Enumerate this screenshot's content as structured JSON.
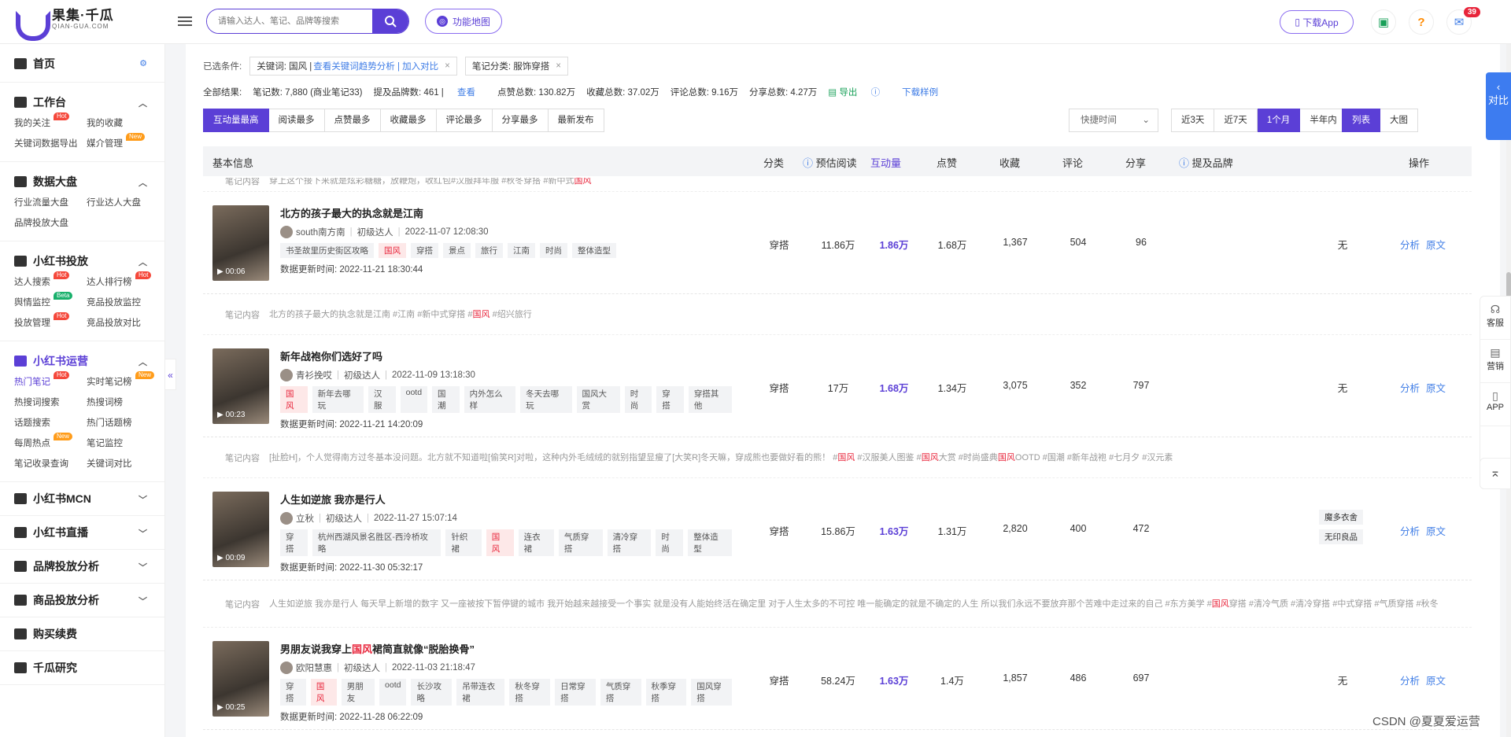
{
  "topbar": {
    "logo_title": "果集·千瓜",
    "logo_sub": "QIAN-GUA.COM",
    "search_placeholder": "请输入达人、笔记、品牌等搜索",
    "func_map": "功能地图",
    "download_app": "下载App",
    "msg_count": "39"
  },
  "sidebar": {
    "home": "首页",
    "sections": [
      {
        "title": "工作台",
        "items": [
          {
            "label": "我的关注",
            "tag": "Hot"
          },
          {
            "label": "我的收藏",
            "tag": ""
          },
          {
            "label": "关键词数据导出",
            "tag": ""
          },
          {
            "label": "媒介管理",
            "tag": "New"
          }
        ]
      },
      {
        "title": "数据大盘",
        "items": [
          {
            "label": "行业流量大盘",
            "tag": ""
          },
          {
            "label": "行业达人大盘",
            "tag": ""
          },
          {
            "label": "品牌投放大盘",
            "tag": ""
          }
        ]
      },
      {
        "title": "小红书投放",
        "items": [
          {
            "label": "达人搜索",
            "tag": "Hot"
          },
          {
            "label": "达人排行榜",
            "tag": "Hot"
          },
          {
            "label": "舆情监控",
            "tag": "Beta"
          },
          {
            "label": "竞品投放监控",
            "tag": ""
          },
          {
            "label": "投放管理",
            "tag": "Hot"
          },
          {
            "label": "竞品投放对比",
            "tag": ""
          }
        ]
      },
      {
        "title": "小红书运营",
        "items": [
          {
            "label": "热门笔记",
            "tag": "Hot"
          },
          {
            "label": "实时笔记榜",
            "tag": "New"
          },
          {
            "label": "热搜词搜索",
            "tag": ""
          },
          {
            "label": "热搜词榜",
            "tag": ""
          },
          {
            "label": "话题搜索",
            "tag": ""
          },
          {
            "label": "热门话题榜",
            "tag": ""
          },
          {
            "label": "每周热点",
            "tag": "New"
          },
          {
            "label": "笔记监控",
            "tag": ""
          },
          {
            "label": "笔记收录查询",
            "tag": ""
          },
          {
            "label": "关键词对比",
            "tag": ""
          }
        ]
      }
    ],
    "collapsed": [
      "小红书MCN",
      "小红书直播",
      "品牌投放分析",
      "商品投放分析",
      "购买续费",
      "千瓜研究"
    ]
  },
  "filters": {
    "label": "已选条件:",
    "chip1_prefix": "关键词: 国风 |",
    "chip1_link": "查看关键词趋势分析 | 加入对比",
    "chip2": "笔记分类: 服饰穿搭"
  },
  "summary": {
    "total": "全部结果:",
    "notes": "笔记数: 7,880 (商业笔记33)",
    "brands": "提及品牌数: 461 |",
    "brands_link": "查看",
    "likes": "点赞总数: 130.82万",
    "collects": "收藏总数: 37.02万",
    "comments": "评论总数: 9.16万",
    "shares": "分享总数: 4.27万",
    "export": "导出",
    "sample": "下载样例"
  },
  "sort_buttons": [
    "互动量最高",
    "阅读最多",
    "点赞最多",
    "收藏最多",
    "评论最多",
    "分享最多",
    "最新发布"
  ],
  "quick_time": "快捷时间",
  "ranges": [
    "近3天",
    "近7天",
    "1个月",
    "半年内"
  ],
  "views": [
    "列表",
    "大图"
  ],
  "table_headers": [
    "基本信息",
    "分类",
    "预估阅读",
    "互动量",
    "点赞",
    "收藏",
    "评论",
    "分享",
    "提及品牌",
    "操作"
  ],
  "note_label": "笔记内容",
  "top_note": "穿上这个接下来就是炫彩糖糖，放鞭炮，收红包#汉服拜年服 #秋冬穿搭 #新中式国风",
  "rows": [
    {
      "title": "北方的孩子最大的执念就是江南",
      "author": "south南方南",
      "level": "初级达人",
      "time": "2022-11-07 12:08:30",
      "tags": [
        "书圣故里历史街区攻略",
        "国风",
        "穿搭",
        "景点",
        "旅行",
        "江南",
        "时尚",
        "整体造型"
      ],
      "update": "数据更新时间: 2022-11-21 18:30:44",
      "duration": "00:06",
      "category": "穿搭",
      "read": "11.86万",
      "interact": "1.86万",
      "likes": "1.68万",
      "collect": "1,367",
      "comment": "504",
      "share": "96",
      "brands": [
        "无"
      ],
      "note": "北方的孩子最大的执念就是江南 #江南 #新中式穿搭 #国风 #绍兴旅行"
    },
    {
      "title": "新年战袍你们选好了吗",
      "author": "青衫挽哎",
      "level": "初级达人",
      "time": "2022-11-09 13:18:30",
      "tags": [
        "国风",
        "新年去哪玩",
        "汉服",
        "ootd",
        "国潮",
        "内外怎么样",
        "冬天去哪玩",
        "国风大赏",
        "时尚",
        "穿搭",
        "穿搭其他"
      ],
      "update": "数据更新时间: 2022-11-21 14:20:09",
      "duration": "00:23",
      "category": "穿搭",
      "read": "17万",
      "interact": "1.68万",
      "likes": "1.34万",
      "collect": "3,075",
      "comment": "352",
      "share": "797",
      "brands": [
        "无"
      ],
      "note": "[扯脸H]，个人觉得南方过冬基本没问题。北方就不知道啦[偷笑R]对啦，这种内外毛绒绒的就别指望显瘦了[大笑R]冬天嘛，穿成熊也要做好看的熊！ #国风 #汉服美人图鉴 #国风大赏 #时尚盛典国风OOTD #国潮 #新年战袍 #七月夕 #汉元素"
    },
    {
      "title": "人生如逆旅 我亦是行人",
      "author": "立秋",
      "level": "初级达人",
      "time": "2022-11-27 15:07:14",
      "tags": [
        "穿搭",
        "杭州西湖风景名胜区-西泠桥攻略",
        "针织裙",
        "国风",
        "连衣裙",
        "气质穿搭",
        "清冷穿搭",
        "时尚",
        "整体造型"
      ],
      "update": "数据更新时间: 2022-11-30 05:32:17",
      "duration": "00:09",
      "category": "穿搭",
      "read": "15.86万",
      "interact": "1.63万",
      "likes": "1.31万",
      "collect": "2,820",
      "comment": "400",
      "share": "472",
      "brands": [
        "魔多衣舍",
        "无印良品"
      ],
      "note": "人生如逆旅 我亦是行人 每天早上新增的数字 又一座被按下暂停键的城市 我开始越来越接受一个事实 就是没有人能始终活在确定里 对于人生太多的不可控 唯一能确定的就是不确定的人生 所以我们永远不要放弃那个苦难中走过来的自己 #东方美学 #国风穿搭 #清冷气质 #清冷穿搭 #中式穿搭 #气质穿搭 #秋冬"
    },
    {
      "title": "男朋友说我穿上国风裙简直就像“脱胎换骨”",
      "author": "欧阳慧惠",
      "level": "初级达人",
      "time": "2022-11-03 21:18:47",
      "tags": [
        "穿搭",
        "国风",
        "男朋友",
        "ootd",
        "长沙攻略",
        "吊带连衣裙",
        "秋冬穿搭",
        "日常穿搭",
        "气质穿搭",
        "秋季穿搭",
        "国风穿搭"
      ],
      "update": "数据更新时间: 2022-11-28 06:22:09",
      "duration": "00:25",
      "category": "穿搭",
      "read": "58.24万",
      "interact": "1.63万",
      "likes": "1.4万",
      "collect": "1,857",
      "comment": "486",
      "share": "697",
      "brands": [
        "无"
      ],
      "note": ""
    }
  ],
  "ops": [
    "分析",
    "原文"
  ],
  "right_tab": "对比",
  "right_bar": [
    "客服",
    "营销",
    "APP"
  ],
  "watermark": "CSDN @夏夏爱运营",
  "accent": "#5b3fd6"
}
